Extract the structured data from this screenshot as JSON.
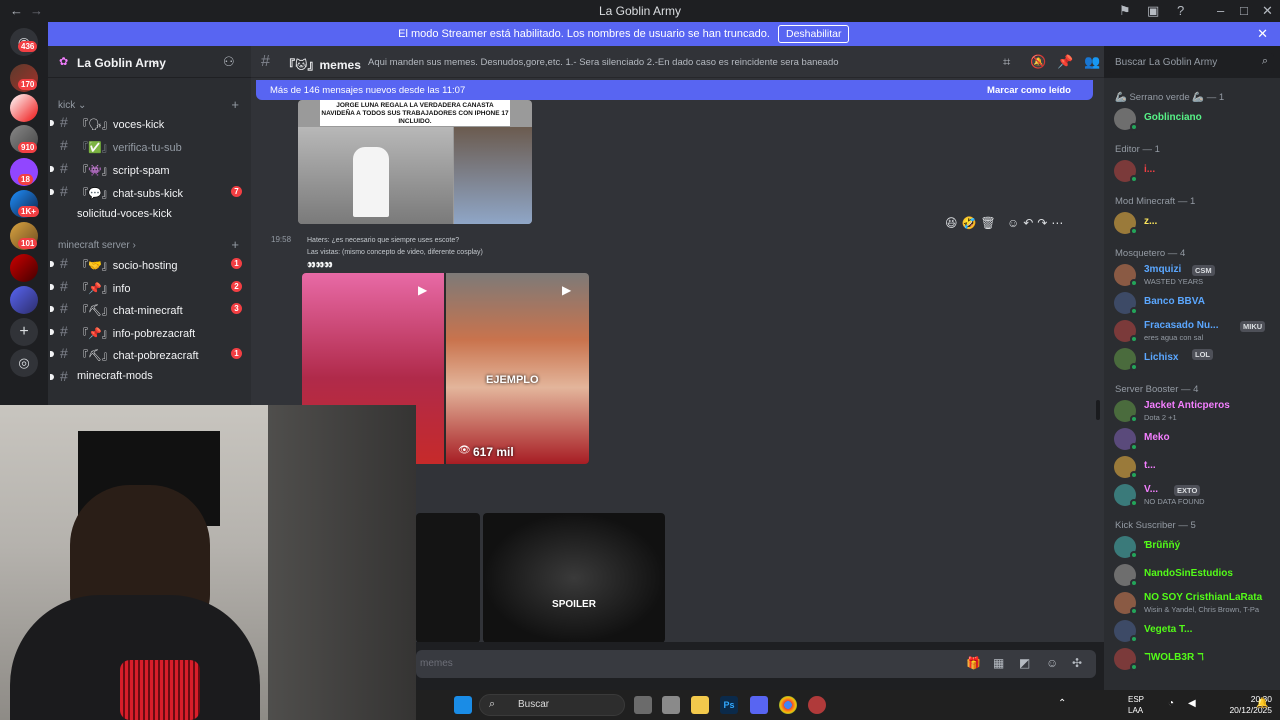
{
  "window": {
    "title": "La Goblin Army"
  },
  "banner": {
    "message": "El modo Streamer está habilitado. Los nombres de usuario se han truncado.",
    "button": "Deshabilitar"
  },
  "rail": {
    "badges": [
      "436",
      "170",
      "910",
      "18",
      "1K+",
      "101"
    ],
    "accent": "#f23f43"
  },
  "server": {
    "name": "La Goblin Army"
  },
  "sidebar": {
    "categories": [
      {
        "label": "kick"
      },
      {
        "label": "minecraft server"
      }
    ],
    "channels_kick": [
      {
        "label": "『🗣』voces-kick",
        "badge": ""
      },
      {
        "label": "『✅』verifica-tu-sub",
        "badge": ""
      },
      {
        "label": "『👾』script-spam",
        "badge": ""
      },
      {
        "label": "『💬』chat-subs-kick",
        "badge": "7"
      },
      {
        "label": "solicitud-voces-kick",
        "badge": ""
      }
    ],
    "channels_mc": [
      {
        "label": "『🤝』socio-hosting",
        "badge": "1"
      },
      {
        "label": "『📌』info",
        "badge": "2"
      },
      {
        "label": "『⛏』chat-minecraft",
        "badge": "3"
      },
      {
        "label": "『📌』info-pobrezacraft",
        "badge": ""
      },
      {
        "label": "『⛏』chat-pobrezacraft",
        "badge": "1"
      },
      {
        "label": "minecraft-mods",
        "badge": ""
      }
    ]
  },
  "channel": {
    "name": "『🐱』memes",
    "topic": "Aqui manden sus memes. Desnudos,gore,etc. 1.- Sera silenciado 2.-En dado caso es reincidente sera baneado"
  },
  "search": {
    "placeholder": "Buscar La Goblin Army"
  },
  "chat": {
    "new_messages": "Más de 146 mensajes nuevos desde las 11:07",
    "mark_read": "Marcar como leído",
    "meme_headline": "JORGE LUNA REGALA LA VERDADERA CANASTA NAVIDEÑA A TODOS SUS TRABAJADORES CON IPHONE 17 INCLUIDO.",
    "timestamp": "19:58",
    "line1": "Haters: ¿es necesario que siempre uses escote?",
    "line2": "Las vistas: (mismo concepto de video, diferente cosplay)",
    "line3": "👀👀👀",
    "ejemplo": "EJEMPLO",
    "views": "617 mil",
    "spoiler": "SPOILER"
  },
  "composer": {
    "placeholder": "memes"
  },
  "members": {
    "groups": [
      {
        "header": "🦾 Serrano verde 🦾 — 1",
        "items": [
          {
            "name": "Goblinciano",
            "sub": "",
            "color": "#57f287",
            "tag": ""
          }
        ]
      },
      {
        "header": "Editor — 1",
        "items": [
          {
            "name": "i...",
            "sub": "",
            "color": "#f23f43",
            "tag": ""
          }
        ]
      },
      {
        "header": "Mod Minecraft — 1",
        "items": [
          {
            "name": "z...",
            "sub": "",
            "color": "#fee75c",
            "tag": ""
          }
        ]
      },
      {
        "header": "Mosquetero — 4",
        "items": [
          {
            "name": "3mquizi",
            "sub": "WASTED YEARS",
            "color": "#5ba7ff",
            "tag": "CSM"
          },
          {
            "name": "Banco BBVA",
            "sub": "",
            "color": "#5ba7ff",
            "tag": ""
          },
          {
            "name": "Fracasado Nu...",
            "sub": "eres agua con sal",
            "color": "#5ba7ff",
            "tag": "MIKU"
          },
          {
            "name": "Lichisx",
            "sub": "",
            "color": "#5ba7ff",
            "tag": "LOL"
          }
        ]
      },
      {
        "header": "Server Booster — 4",
        "items": [
          {
            "name": "Jacket Anticperos",
            "sub": "Dota 2 +1",
            "color": "#f47fff",
            "tag": ""
          },
          {
            "name": "Meko",
            "sub": "",
            "color": "#f47fff",
            "tag": ""
          },
          {
            "name": "t...",
            "sub": "",
            "color": "#f47fff",
            "tag": ""
          },
          {
            "name": "V...",
            "sub": "NO DATA FOUND",
            "color": "#f47fff",
            "tag": "EXTO"
          }
        ]
      },
      {
        "header": "Kick Suscriber — 5",
        "items": [
          {
            "name": "Ɓrũñňý",
            "sub": "",
            "color": "#53fc18",
            "tag": ""
          },
          {
            "name": "NandoSinEstudios",
            "sub": "",
            "color": "#53fc18",
            "tag": ""
          },
          {
            "name": "NO SOY CristhianLaRata",
            "sub": "Wisin & Yandel, Chris Brown, T-Pa",
            "color": "#53fc18",
            "tag": ""
          },
          {
            "name": "Vegeta T...",
            "sub": "",
            "color": "#53fc18",
            "tag": ""
          },
          {
            "name": "ℸWOLB3R ℸ",
            "sub": "",
            "color": "#53fc18",
            "tag": ""
          }
        ]
      }
    ]
  },
  "taskbar": {
    "search": "Buscar",
    "lang1": "ESP",
    "lang2": "LAA",
    "time": "20:30",
    "date": "20/12/2025"
  }
}
